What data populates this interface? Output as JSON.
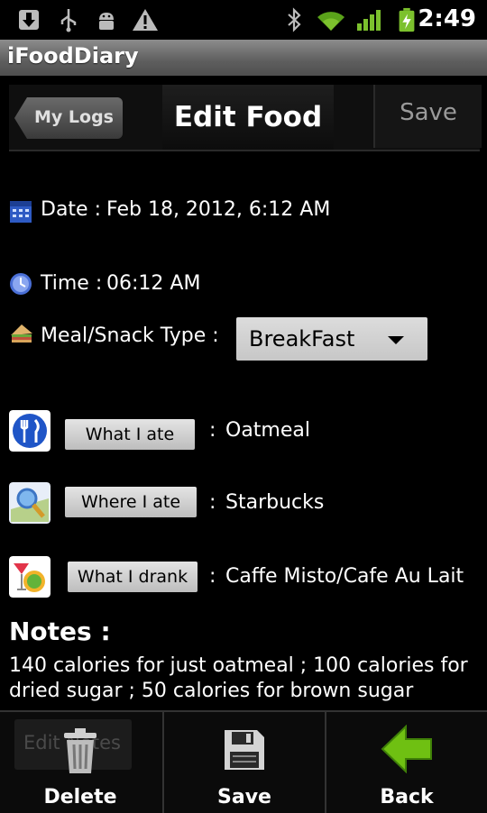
{
  "status_bar": {
    "time": "2:49",
    "icons": [
      "download-icon",
      "usb-icon",
      "android-debug-icon",
      "warning-icon",
      "bluetooth-icon",
      "wifi-icon",
      "signal-icon",
      "battery-charging-icon"
    ]
  },
  "app": {
    "title": "iFoodDiary"
  },
  "nav": {
    "back_label": "My Logs",
    "title": "Edit Food",
    "save_label": "Save"
  },
  "form": {
    "date": {
      "label": "Date :",
      "value": "Feb 18, 2012, 6:12 AM"
    },
    "time": {
      "label": "Time :",
      "value": "06:12 AM"
    },
    "meal": {
      "label": "Meal/Snack Type :",
      "selected": "BreakFast"
    },
    "ate": {
      "button": "What I ate",
      "sep": ":",
      "value": "Oatmeal"
    },
    "where": {
      "button": "Where I ate",
      "sep": ":",
      "value": "Starbucks"
    },
    "drank": {
      "button": "What I drank",
      "sep": ":",
      "value": "Caffe Misto/Cafe Au Lait"
    }
  },
  "notes": {
    "heading": "Notes :",
    "text": "140 calories for just oatmeal ; 100 calories for dried sugar ; 50 calories for brown sugar",
    "edit_button": "Edit Notes"
  },
  "bottom_bar": {
    "delete": "Delete",
    "save": "Save",
    "back": "Back"
  },
  "colors": {
    "background": "#000000",
    "title_bar": "#6e6e6e",
    "accent_green": "#6fc012",
    "signal_green": "#7cc12d"
  }
}
